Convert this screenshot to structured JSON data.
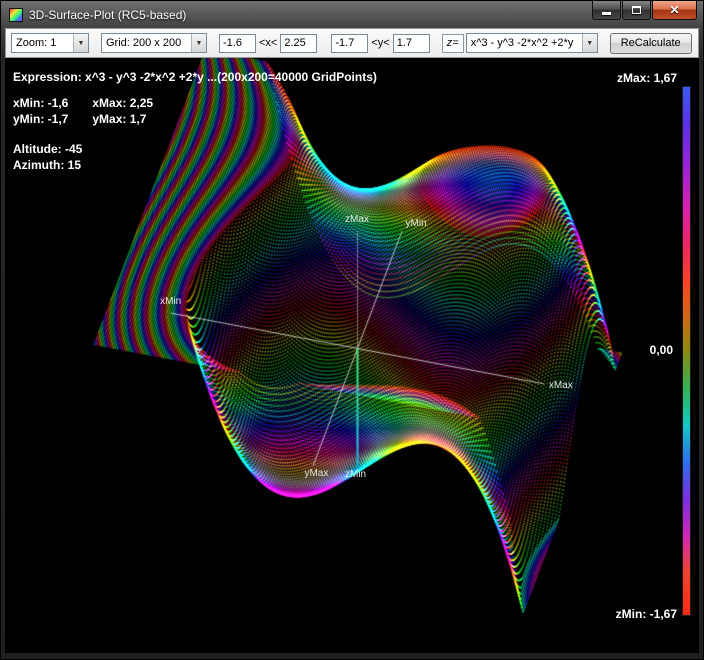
{
  "window": {
    "title": "3D-Surface-Plot (RC5-based)"
  },
  "toolbar": {
    "zoom_value": "Zoom: 1",
    "grid_value": "Grid: 200 x 200",
    "x_min": "-1.6",
    "x_between": "<x<",
    "x_max": "2.25",
    "y_min": "-1.7",
    "y_between": "<y<",
    "y_max": "1.7",
    "z_equals": "z=",
    "expression_value": "x^3 - y^3 -2*x^2 +2*y",
    "recalculate_label": "ReCalculate"
  },
  "plot": {
    "header": "Expression: x^3 - y^3 -2*x^2 +2*y   ...(200x200=40000 GridPoints)",
    "xmin_text": "xMin: -1,6",
    "xmax_text": "xMax: 2,25",
    "ymin_text": "yMin: -1,7",
    "ymax_text": "yMax: 1,7",
    "altitude_text": "Altitude: -45",
    "azimuth_text": "Azimuth: 15",
    "zmax_text": "zMax: 1,67",
    "zmid_text": "0,00",
    "zmin_text": "zMin: -1,67",
    "axis_labels": {
      "zmax": "zMax",
      "ymin": "yMin",
      "xmin": "xMin",
      "xmax": "xMax",
      "ymax": "yMax",
      "zmin": "zMin"
    },
    "colorbar_stops": [
      {
        "p": 0,
        "c": "#3b5bff"
      },
      {
        "p": 7,
        "c": "#5a2fe8"
      },
      {
        "p": 15,
        "c": "#9b23d8"
      },
      {
        "p": 23,
        "c": "#d81fae"
      },
      {
        "p": 30,
        "c": "#f32560"
      },
      {
        "p": 37,
        "c": "#ff4426"
      },
      {
        "p": 44,
        "c": "#cc6a14"
      },
      {
        "p": 50,
        "c": "#8a8a10"
      },
      {
        "p": 57,
        "c": "#35b153"
      },
      {
        "p": 64,
        "c": "#12c9c2"
      },
      {
        "p": 71,
        "c": "#2e6ef0"
      },
      {
        "p": 78,
        "c": "#7a2ee0"
      },
      {
        "p": 85,
        "c": "#d128b8"
      },
      {
        "p": 92,
        "c": "#f2442c"
      },
      {
        "p": 100,
        "c": "#ff2a18"
      }
    ]
  },
  "chart_data": {
    "type": "scatter",
    "title": "3D surface point plot of z = x^3 - y^3 -2*x^2 +2*y",
    "expression": "x^3 - y^3 -2*x^2 +2*y",
    "x_range": [
      -1.6,
      2.25
    ],
    "y_range": [
      -1.7,
      1.7
    ],
    "grid": [
      200,
      200
    ],
    "grid_points": 40000,
    "altitude": -45,
    "azimuth": 15,
    "z_display": {
      "min": -1.67,
      "mid": 0.0,
      "max": 1.67
    },
    "colormap": {
      "type": "cyclic-rainbow",
      "period": 1.4,
      "phase": 0.311
    }
  }
}
